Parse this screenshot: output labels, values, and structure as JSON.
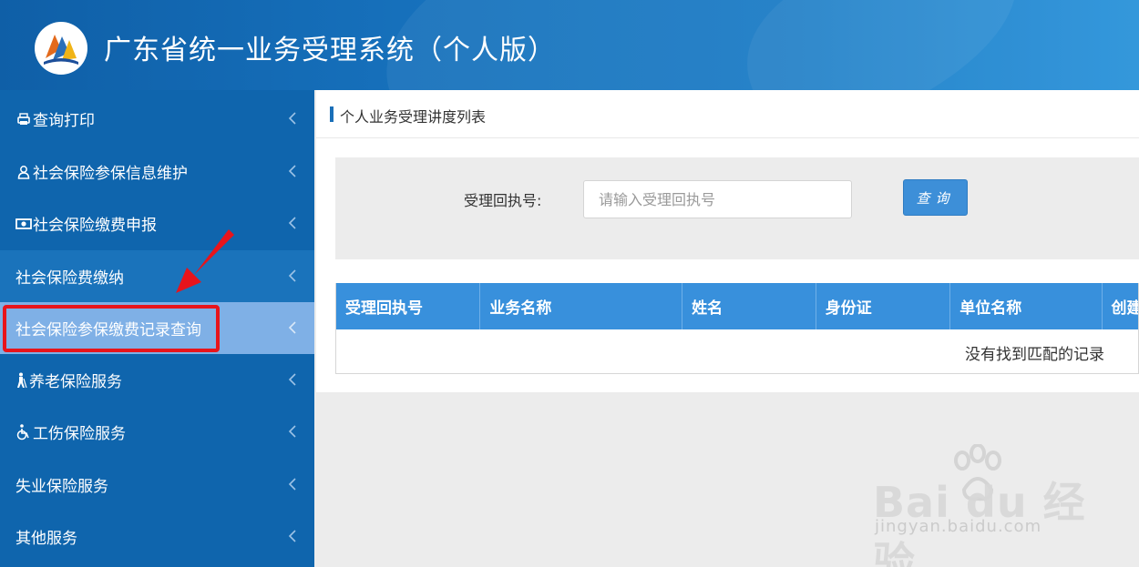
{
  "app": {
    "title": "广东省统一业务受理系统（个人版）"
  },
  "sidebar": {
    "items": [
      {
        "label": "查询打印",
        "icon": "printer-icon"
      },
      {
        "label": "社会保险参保信息维护",
        "icon": "user-icon"
      },
      {
        "label": "社会保险缴费申报",
        "icon": "money-icon"
      },
      {
        "label": "社会保险费缴纳",
        "icon": ""
      },
      {
        "label": "社会保险参保缴费记录查询",
        "icon": ""
      },
      {
        "label": "养老保险服务",
        "icon": "elderly-icon"
      },
      {
        "label": "工伤保险服务",
        "icon": "wheelchair-icon"
      },
      {
        "label": "失业保险服务",
        "icon": ""
      },
      {
        "label": "其他服务",
        "icon": ""
      }
    ]
  },
  "panel": {
    "title": "个人业务受理讲度列表"
  },
  "search": {
    "label": "受理回执号:",
    "placeholder": "请输入受理回执号",
    "button_label": "查询"
  },
  "table": {
    "columns": [
      "受理回执号",
      "业务名称",
      "姓名",
      "身份证",
      "单位名称",
      "创建"
    ],
    "empty_message": "没有找到匹配的记录"
  },
  "watermark": {
    "brand": "Bai du 经验",
    "url": "jingyan.baidu.com"
  },
  "colors": {
    "header_blue": "#1670bb",
    "sidebar_blue": "#0f65ad",
    "selected_item": "#7fb0e6",
    "table_header": "#3890dc",
    "highlight_red": "#e8141b"
  }
}
